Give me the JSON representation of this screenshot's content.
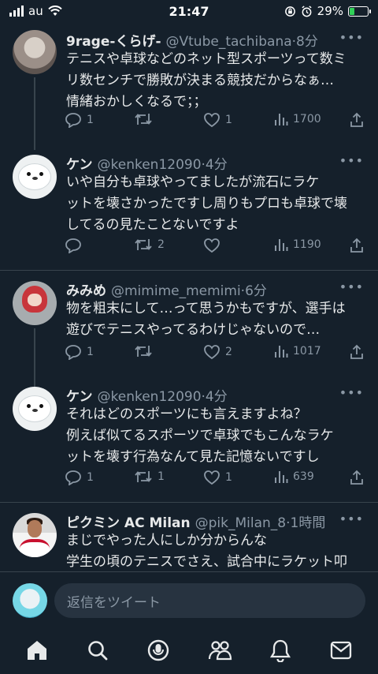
{
  "status_bar": {
    "carrier": "au",
    "time": "21:47",
    "battery_percent": "29%",
    "battery_level": 0.29,
    "icons": [
      "signal-icon",
      "wifi-icon",
      "orientation-lock-icon",
      "alarm-icon",
      "battery-icon"
    ]
  },
  "tweets": [
    {
      "name": "9rage-くらげ-",
      "handle": "@Vtube_tachibana",
      "time": "·8分",
      "lines": [
        "テニスや卓球などのネット型スポーツって数ミ",
        "リ数センチで勝敗が決まる競技だからなぁ…",
        "情緒おかしくなるで；；"
      ],
      "replies": "1",
      "retweets": "",
      "likes": "1",
      "views": "1700"
    },
    {
      "name": "ケン",
      "handle": "@kenken12090",
      "time": "·4分",
      "lines": [
        "いや自分も卓球やってましたが流石にラケ",
        "ットを壊さかったですし周りもプロも卓球で壊",
        "してるの見たことないですよ"
      ],
      "replies": "",
      "retweets": "2",
      "likes": "",
      "views": "1190"
    },
    {
      "name": "みみめ",
      "handle": "@mimime_memimi",
      "time": "·6分",
      "lines": [
        "物を粗末にして…って思うかもですが、選手は",
        "遊びでテニスやってるわけじゃないので…"
      ],
      "replies": "1",
      "retweets": "",
      "likes": "2",
      "views": "1017"
    },
    {
      "name": "ケン",
      "handle": "@kenken12090",
      "time": "·4分",
      "lines": [
        "それはどのスポーツにも言えますよね？",
        "例えば似てるスポーツで卓球でもこんなラケ",
        "ットを壊す行為なんて見た記憶ないですし"
      ],
      "replies": "1",
      "retweets": "1",
      "likes": "1",
      "views": "639"
    },
    {
      "name": "ピクミン AC Milan",
      "handle": "@pik_Milan_8",
      "time": "·1時間",
      "lines": [
        "まじでやった人にしか分からんな",
        "学生の頃のテニスでさえ、試合中にラケット叩"
      ],
      "replies": "",
      "retweets": "",
      "likes": "",
      "views": ""
    }
  ],
  "reply_bar": {
    "placeholder": "返信をツイート"
  },
  "tab_bar": {
    "tabs": [
      "home-icon",
      "search-icon",
      "spaces-icon",
      "communities-icon",
      "notifications-icon",
      "messages-icon"
    ]
  },
  "colors": {
    "background": "#15202b",
    "text": "#e7e9ea",
    "muted": "#8b98a5",
    "divider": "#38444d"
  }
}
